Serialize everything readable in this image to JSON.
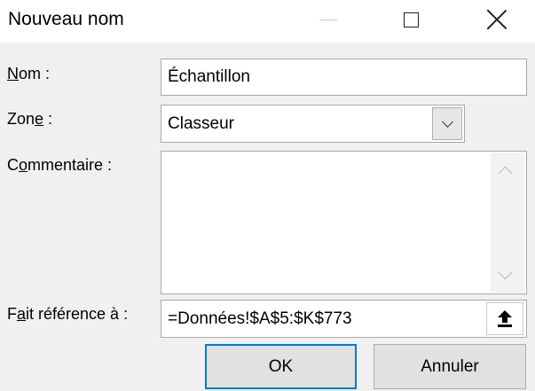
{
  "window": {
    "title": "Nouveau nom",
    "minimize_icon": "minimize-icon",
    "maximize_icon": "maximize-icon",
    "close_icon": "close-icon"
  },
  "fields": {
    "nom": {
      "label_pre": "",
      "label_mnemonic": "N",
      "label_post": "om :",
      "value": "Échantillon"
    },
    "zone": {
      "label_pre": "Zon",
      "label_mnemonic": "e",
      "label_post": " :",
      "value": "Classeur",
      "dropdown_icon": "chevron-down-icon"
    },
    "commentaire": {
      "label_pre": "C",
      "label_mnemonic": "o",
      "label_post": "mmentaire :",
      "value": ""
    },
    "reference": {
      "label_pre": "F",
      "label_mnemonic": "a",
      "label_post": "it référence à :",
      "value": "=Données!$A$5:$K$773",
      "collapse_icon": "collapse-dialog-icon"
    }
  },
  "buttons": {
    "ok": "OK",
    "cancel": "Annuler"
  },
  "colors": {
    "accent": "#0078d7",
    "dialog_bg": "#f0f0f0"
  }
}
